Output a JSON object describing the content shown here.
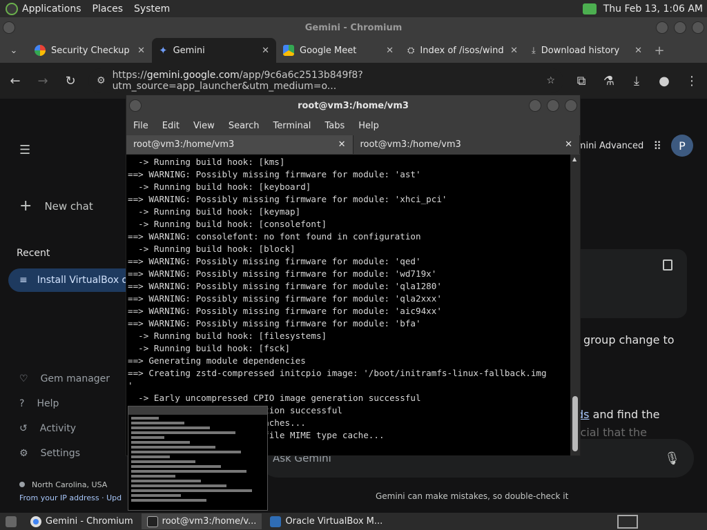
{
  "system_panel": {
    "menus": [
      "Applications",
      "Places",
      "System"
    ],
    "datetime": "Thu Feb 13,  1:06 AM"
  },
  "chromium": {
    "title": "Gemini - Chromium",
    "tabs": [
      {
        "label": "Security Checkup",
        "icon": "google-icon"
      },
      {
        "label": "Gemini",
        "icon": "gemini-icon",
        "active": true
      },
      {
        "label": "Google Meet",
        "icon": "meet-icon"
      },
      {
        "label": "Index of /isos/wind",
        "icon": "globe-icon"
      },
      {
        "label": "Download history",
        "icon": "download-icon"
      }
    ],
    "url_prefix": "https://",
    "url_host": "gemini.google.com",
    "url_rest": "/app/9c6a6c2513b849f8?utm_source=app_launcher&utm_medium=o..."
  },
  "gemini": {
    "new_chat": "New chat",
    "recent_label": "Recent",
    "recent_item": "Install VirtualBox o",
    "side_links": [
      "Gem manager",
      "Help",
      "Activity",
      "Settings"
    ],
    "location": "North Carolina, USA",
    "location_sub": "From your IP address",
    "location_sub_more": "Upd",
    "advanced_label": "mini Advanced",
    "avatar_letter": "P",
    "resp_line1": "group change to",
    "resp_link": "ds",
    "resp_line2": " and find the",
    "resp_line3": "crucial that the",
    "ask_placeholder": "Ask Gemini",
    "disclaimer": "Gemini can make mistakes, so double-check it"
  },
  "terminal": {
    "title": "root@vm3:/home/vm3",
    "menu": [
      "File",
      "Edit",
      "View",
      "Search",
      "Terminal",
      "Tabs",
      "Help"
    ],
    "tabs": [
      "root@vm3:/home/vm3",
      "root@vm3:/home/vm3"
    ],
    "lines": [
      "  -> Running build hook: [kms]",
      "==> WARNING: Possibly missing firmware for module: 'ast'",
      "  -> Running build hook: [keyboard]",
      "==> WARNING: Possibly missing firmware for module: 'xhci_pci'",
      "  -> Running build hook: [keymap]",
      "  -> Running build hook: [consolefont]",
      "==> WARNING: consolefont: no font found in configuration",
      "  -> Running build hook: [block]",
      "==> WARNING: Possibly missing firmware for module: 'qed'",
      "==> WARNING: Possibly missing firmware for module: 'wd719x'",
      "==> WARNING: Possibly missing firmware for module: 'qla1280'",
      "==> WARNING: Possibly missing firmware for module: 'qla2xxx'",
      "==> WARNING: Possibly missing firmware for module: 'aic94xx'",
      "==> WARNING: Possibly missing firmware for module: 'bfa'",
      "  -> Running build hook: [filesystems]",
      "  -> Running build hook: [fsck]",
      "==> Generating module dependencies",
      "==> Creating zstd-compressed initcpio image: '/boot/initramfs-linux-fallback.img",
      "'",
      "  -> Early uncompressed CPIO image generation successful",
      "                          tion successful",
      "                         caches...",
      "                        o file MIME type cache..."
    ]
  },
  "taskbar": {
    "items": [
      {
        "label": "Gemini - Chromium",
        "icon": "chromium-icon"
      },
      {
        "label": "root@vm3:/home/v...",
        "icon": "terminal-icon",
        "active": true
      },
      {
        "label": "Oracle VirtualBox M...",
        "icon": "virtualbox-icon"
      }
    ]
  },
  "colors": {
    "accent_blue": "#a8c7fa",
    "selected_bg": "#1e3a5f"
  }
}
